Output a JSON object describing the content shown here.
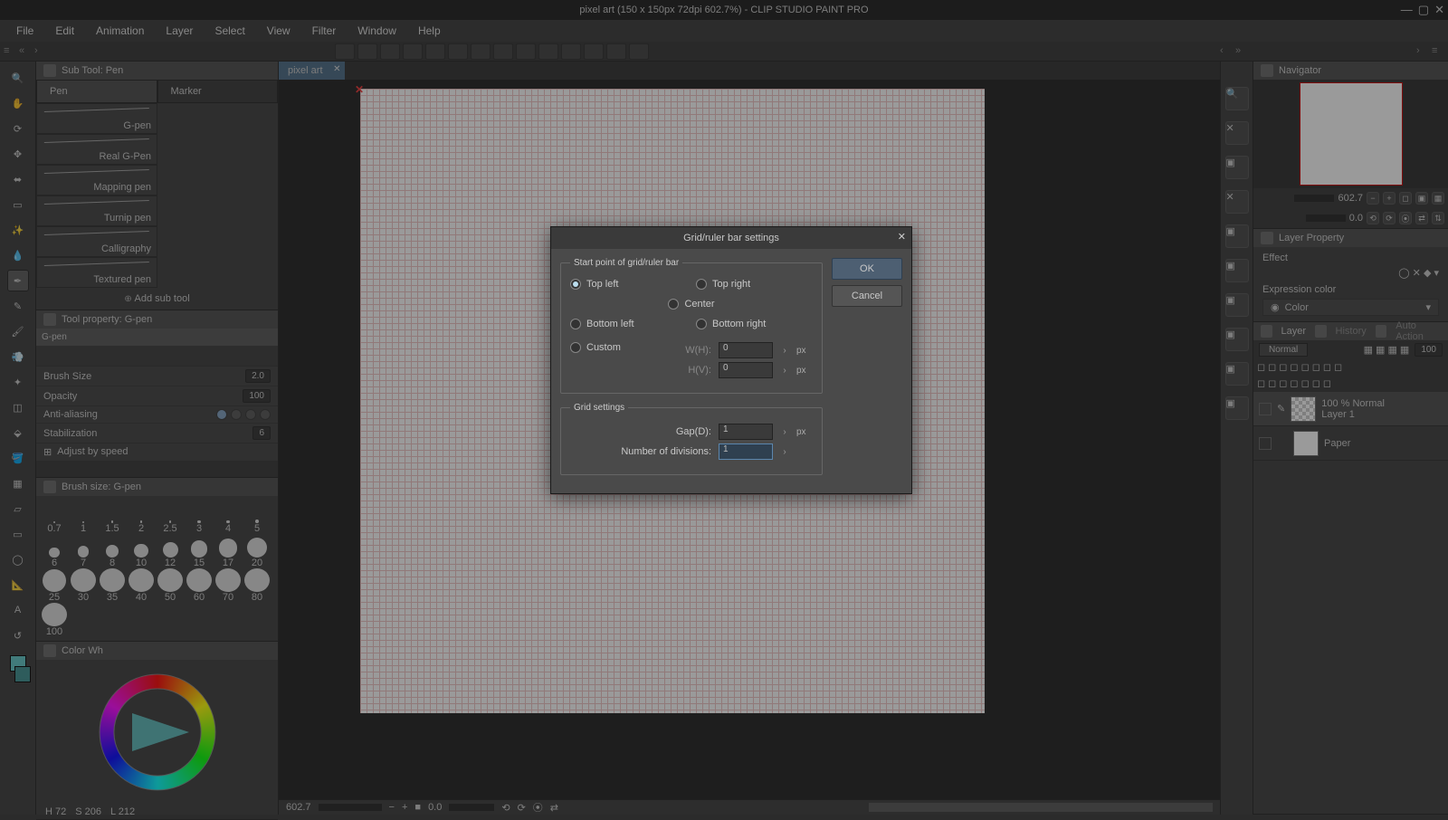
{
  "title": "pixel art (150 x 150px 72dpi 602.7%)  - CLIP STUDIO PAINT PRO",
  "menu": [
    "File",
    "Edit",
    "Animation",
    "Layer",
    "Select",
    "View",
    "Filter",
    "Window",
    "Help"
  ],
  "doc_tab": "pixel art",
  "subtool": {
    "title": "Sub Tool: Pen",
    "tabs": [
      "Pen",
      "Marker"
    ],
    "brushes": [
      "G-pen",
      "Real G-Pen",
      "Mapping pen",
      "Turnip pen",
      "Calligraphy",
      "Textured pen"
    ],
    "add": "Add sub tool"
  },
  "toolprop": {
    "title": "Tool property: G-pen",
    "name": "G-pen",
    "brush_size_label": "Brush Size",
    "brush_size_val": "2.0",
    "opacity_label": "Opacity",
    "opacity_val": "100",
    "aa_label": "Anti-aliasing",
    "stabil_label": "Stabilization",
    "stabil_val": "6",
    "adjust_label": "Adjust by speed"
  },
  "brushsize": {
    "title": "Brush size: G-pen",
    "sizes": [
      "0.7",
      "1",
      "1.5",
      "2",
      "2.5",
      "3",
      "4",
      "5",
      "6",
      "7",
      "8",
      "10",
      "12",
      "15",
      "17",
      "20",
      "25",
      "30",
      "35",
      "40",
      "50",
      "60",
      "70",
      "80",
      "100"
    ]
  },
  "colorwheel": {
    "title": "Color Wh",
    "h": "72",
    "s": "206",
    "l": "212"
  },
  "statusbar": {
    "zoom": "602.7",
    "angle": "0.0"
  },
  "nav": {
    "title": "Navigator",
    "zoom": "602.7",
    "angle": "0.0"
  },
  "layerprop": {
    "title": "Layer Property",
    "effect_label": "Effect",
    "expr_label": "Expression color",
    "expr_value": "Color"
  },
  "layers": {
    "tabs": [
      "Layer",
      "History",
      "Auto Action"
    ],
    "blend": "Normal",
    "opacity": "100",
    "items": [
      {
        "label1": "100 % Normal",
        "label2": "Layer 1"
      },
      {
        "label1": "",
        "label2": "Paper"
      }
    ]
  },
  "dialog": {
    "title": "Grid/ruler bar settings",
    "legend1": "Start point of grid/ruler bar",
    "opts": {
      "tl": "Top left",
      "tr": "Top right",
      "c": "Center",
      "bl": "Bottom left",
      "br": "Bottom right",
      "cu": "Custom"
    },
    "wh_label": "W(H):",
    "hv_label": "H(V):",
    "wh": "0",
    "hv": "0",
    "px": "px",
    "legend2": "Grid settings",
    "gap_label": "Gap(D):",
    "gap": "1",
    "div_label": "Number of divisions:",
    "div": "1",
    "ok": "OK",
    "cancel": "Cancel"
  }
}
